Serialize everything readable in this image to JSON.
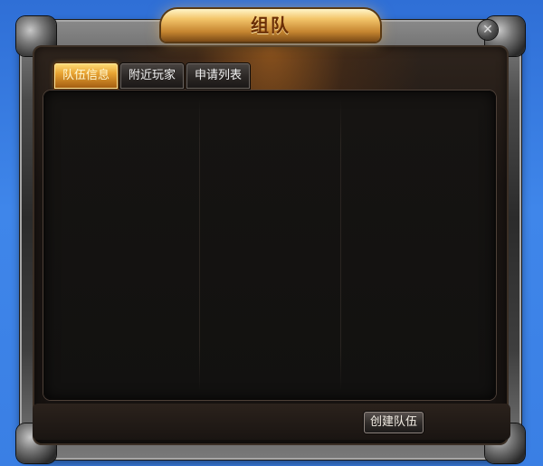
{
  "window": {
    "title": "组队",
    "close_glyph": "✕"
  },
  "tabs": [
    {
      "label": "队伍信息",
      "active": true
    },
    {
      "label": "附近玩家",
      "active": false
    },
    {
      "label": "申请列表",
      "active": false
    }
  ],
  "footer": {
    "create_team_label": "创建队伍"
  },
  "icons": {
    "close": "close-icon"
  },
  "colors": {
    "background_blue": "#3d7fe0",
    "active_tab_gold": "#e8a332",
    "title_text": "#6b2e05"
  }
}
